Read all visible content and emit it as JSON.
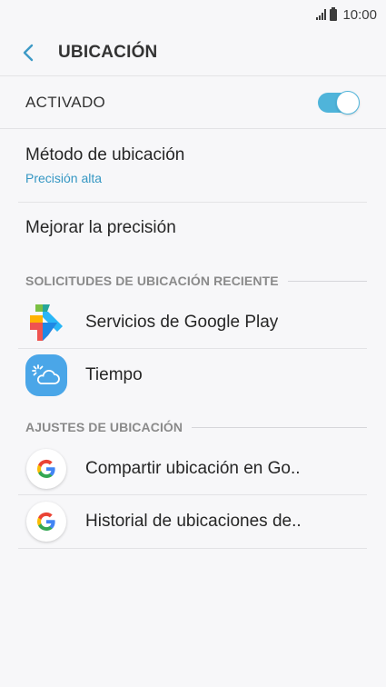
{
  "status_bar": {
    "time": "10:00",
    "icons": [
      "signal-icon",
      "battery-icon"
    ]
  },
  "app_bar": {
    "title": "UBICACIÓN",
    "back_icon": "back-arrow-icon"
  },
  "master_toggle": {
    "label": "ACTIVADO",
    "state": "on",
    "color": "#4fb4da"
  },
  "settings": [
    {
      "title": "Método de ubicación",
      "subtitle": "Precisión alta"
    },
    {
      "title": "Mejorar la precisión"
    }
  ],
  "recent_requests": {
    "header": "SOLICITUDES DE UBICACIÓN RECIENTE",
    "apps": [
      {
        "name": "Servicios de Google Play",
        "icon": "google-play-services-icon"
      },
      {
        "name": "Tiempo",
        "icon": "weather-icon"
      }
    ]
  },
  "location_settings": {
    "header": "AJUSTES DE UBICACIÓN",
    "items": [
      {
        "name": "Compartir ubicación en Go..",
        "icon": "google-icon"
      },
      {
        "name": "Historial de ubicaciones de..",
        "icon": "google-icon"
      }
    ]
  },
  "colors": {
    "accent": "#4fb4da",
    "subtitle": "#3597c3",
    "background": "#f7f7f9"
  }
}
